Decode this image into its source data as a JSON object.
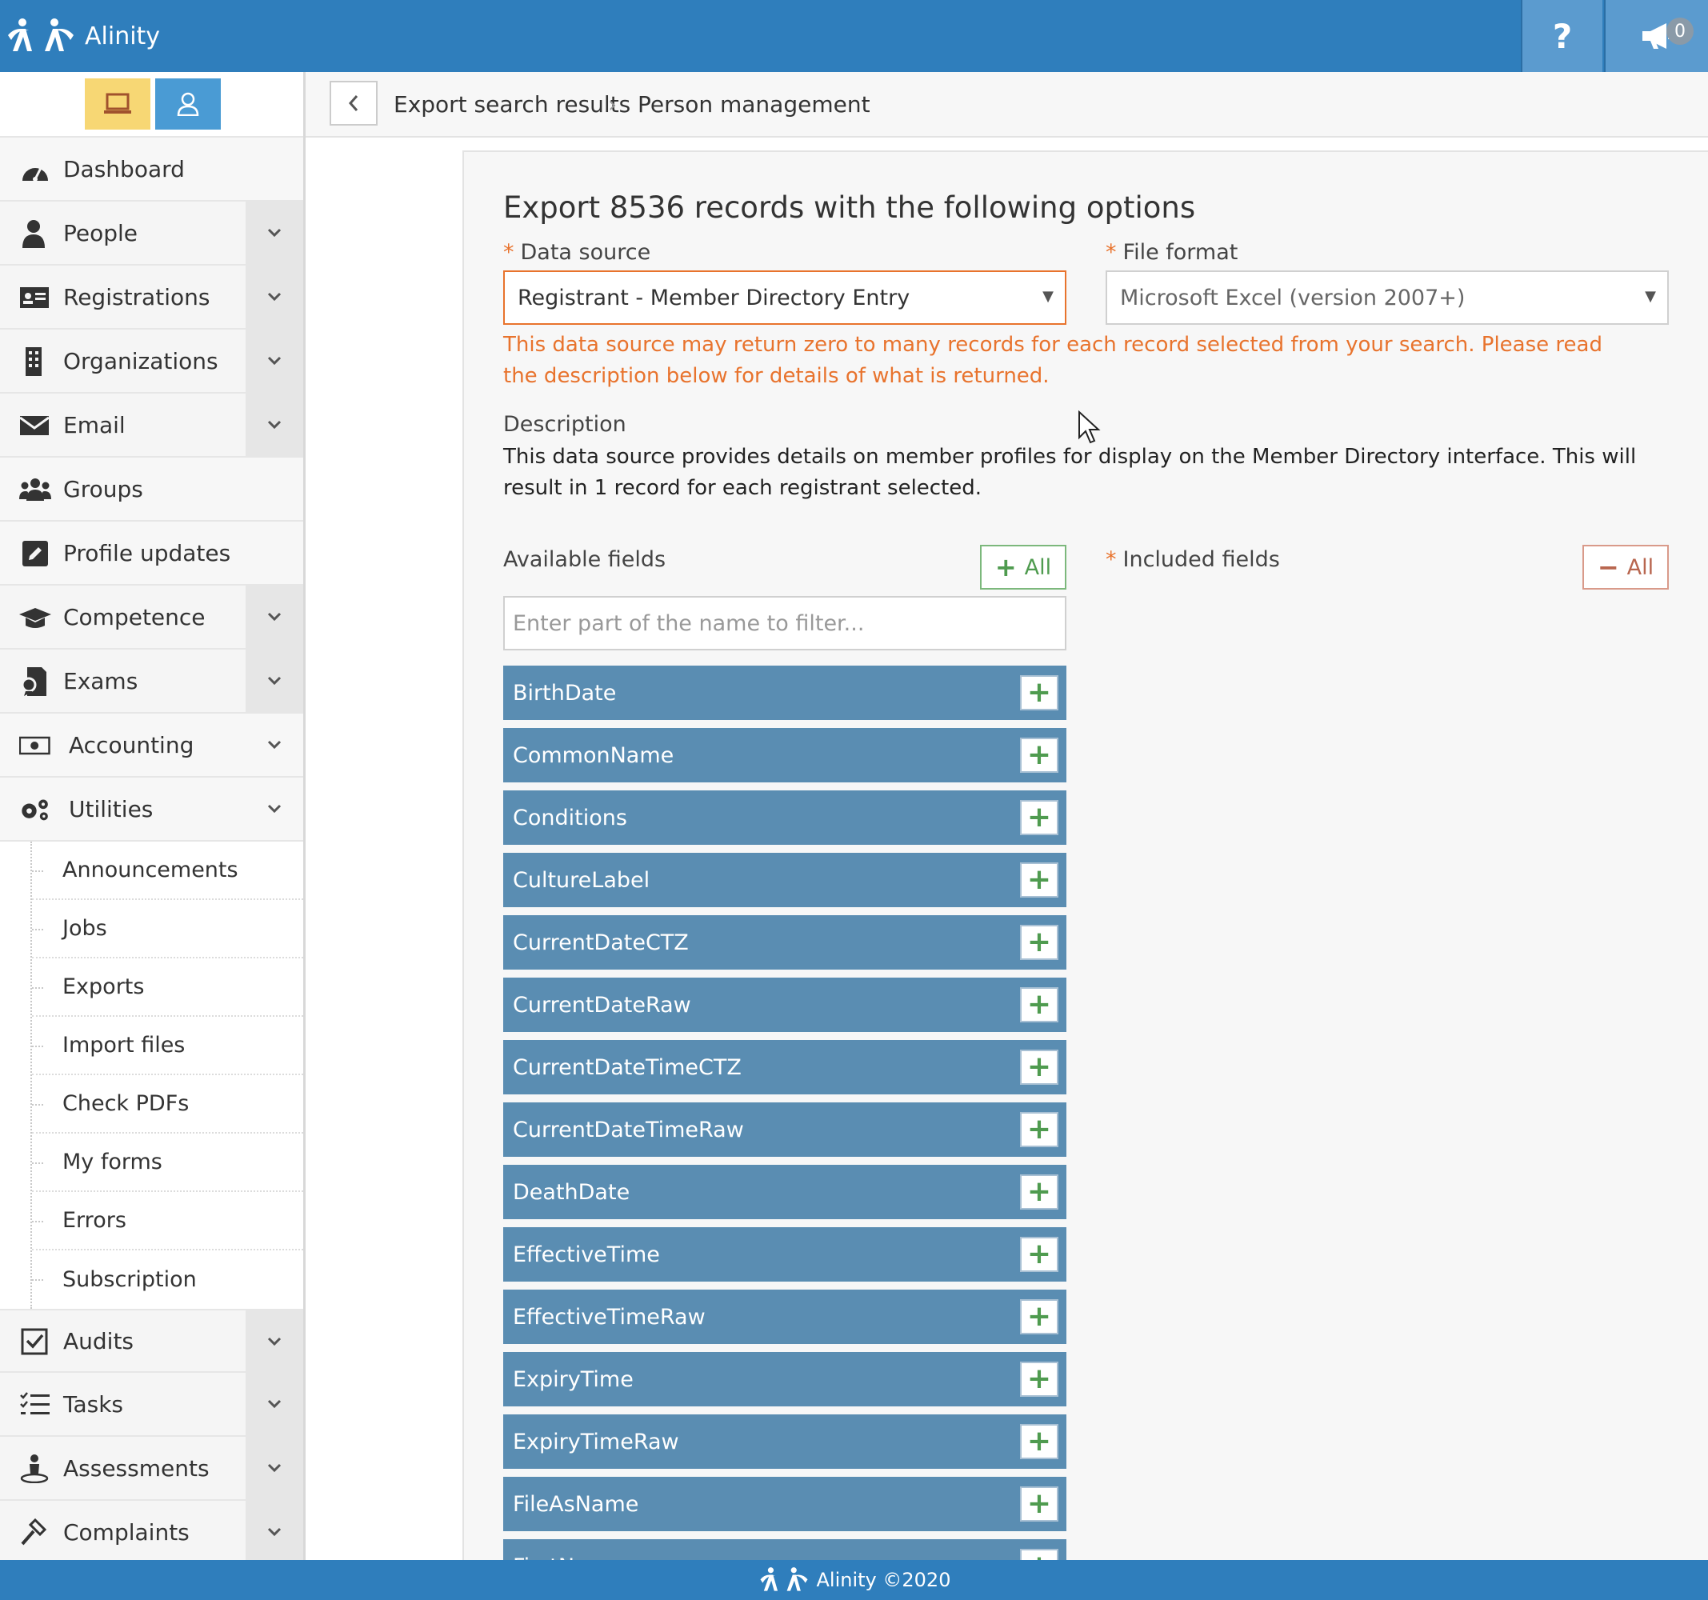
{
  "app": {
    "brand": "Alinity",
    "footer": "Alinity ©2020",
    "badge_count": "0",
    "colors": {
      "primary": "#2f7ebc",
      "warning": "#e8732d",
      "field": "#5a8db2",
      "add": "#4f9b4f"
    }
  },
  "topbar": {
    "help_label": "?"
  },
  "breadcrumb": {
    "items": [
      "Export search results",
      "Person management"
    ],
    "separator": "›"
  },
  "sidebar": {
    "items": [
      {
        "label": "Dashboard",
        "icon": "dashboard-icon"
      },
      {
        "label": "People",
        "icon": "person-icon"
      },
      {
        "label": "Registrations",
        "icon": "id-card-icon"
      },
      {
        "label": "Organizations",
        "icon": "building-icon"
      },
      {
        "label": "Email",
        "icon": "envelope-icon"
      },
      {
        "label": "Groups",
        "icon": "users-icon"
      },
      {
        "label": "Profile updates",
        "icon": "edit-icon"
      },
      {
        "label": "Competence",
        "icon": "graduation-cap-icon"
      },
      {
        "label": "Exams",
        "icon": "exam-icon"
      },
      {
        "label": "Accounting",
        "icon": "money-icon"
      },
      {
        "label": "Utilities",
        "icon": "gears-icon"
      }
    ],
    "utilities_sub": [
      "Announcements",
      "Jobs",
      "Exports",
      "Import files",
      "Check PDFs",
      "My forms",
      "Errors",
      "Subscription"
    ],
    "bottom_items": [
      {
        "label": "Audits",
        "icon": "checkbox-icon"
      },
      {
        "label": "Tasks",
        "icon": "list-icon"
      },
      {
        "label": "Assessments",
        "icon": "assessment-icon"
      },
      {
        "label": "Complaints",
        "icon": "gavel-icon"
      }
    ]
  },
  "export": {
    "title": "Export 8536 records with the following options",
    "data_source_label": "Data source",
    "data_source_value": "Registrant - Member Directory Entry",
    "file_format_label": "File format",
    "file_format_value": "Microsoft Excel (version 2007+)",
    "required_mark": "*",
    "warning": "This data source may return zero to many records for each record selected from your search. Please read the description below for details of what is returned.",
    "description_label": "Description",
    "description": "This data source provides details on member profiles for display on the Member Directory interface. This will result in 1 record for each registrant selected.",
    "available_label": "Available fields",
    "included_label": "Included fields",
    "add_all_label": "All",
    "remove_all_label": "All",
    "filter_placeholder": "Enter part of the name to filter...",
    "available_fields": [
      "BirthDate",
      "CommonName",
      "Conditions",
      "CultureLabel",
      "CurrentDateCTZ",
      "CurrentDateRaw",
      "CurrentDateTimeCTZ",
      "CurrentDateTimeRaw",
      "DeathDate",
      "EffectiveTime",
      "EffectiveTimeRaw",
      "ExpiryTime",
      "ExpiryTimeRaw",
      "FileAsName",
      "FirstN"
    ]
  }
}
